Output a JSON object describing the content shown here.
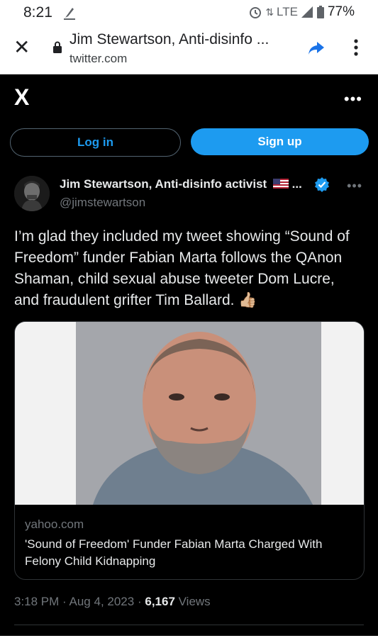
{
  "status": {
    "time": "8:21",
    "network": "LTE",
    "battery": "77%"
  },
  "browser": {
    "title": "Jim Stewartson, Anti-disinfo ...",
    "domain": "twitter.com"
  },
  "xbar": {
    "logo": "X"
  },
  "auth": {
    "login": "Log in",
    "signup": "Sign up"
  },
  "tweet": {
    "author_name": "Jim Stewartson, Anti-disinfo activist",
    "author_suffix": "...",
    "handle": "@jimstewartson",
    "text": "I’m glad they included my tweet showing “Sound of Freedom” funder Fabian Marta follows the QAnon Shaman, child sexual abuse tweeter Dom Lucre, and fraudulent grifter Tim Ballard.",
    "emoji": "👍🏼",
    "card": {
      "domain": "yahoo.com",
      "title": "'Sound of Freedom' Funder Fabian Marta Charged With Felony Child Kidnapping"
    },
    "meta": {
      "time": "3:18 PM",
      "date": "Aug 4, 2023",
      "sep": "·",
      "views_count": "6,167",
      "views_label": "Views"
    }
  },
  "colors": {
    "accent": "#1d9bf0",
    "background": "#000000",
    "text": "#e7e9ea",
    "muted": "#71767b"
  },
  "icons": [
    "signal-icon",
    "alarm-icon",
    "battery-icon",
    "close-icon",
    "lock-icon",
    "share-icon",
    "more-vert-icon",
    "more-horiz-icon",
    "verified-badge-icon",
    "us-flag-icon"
  ]
}
